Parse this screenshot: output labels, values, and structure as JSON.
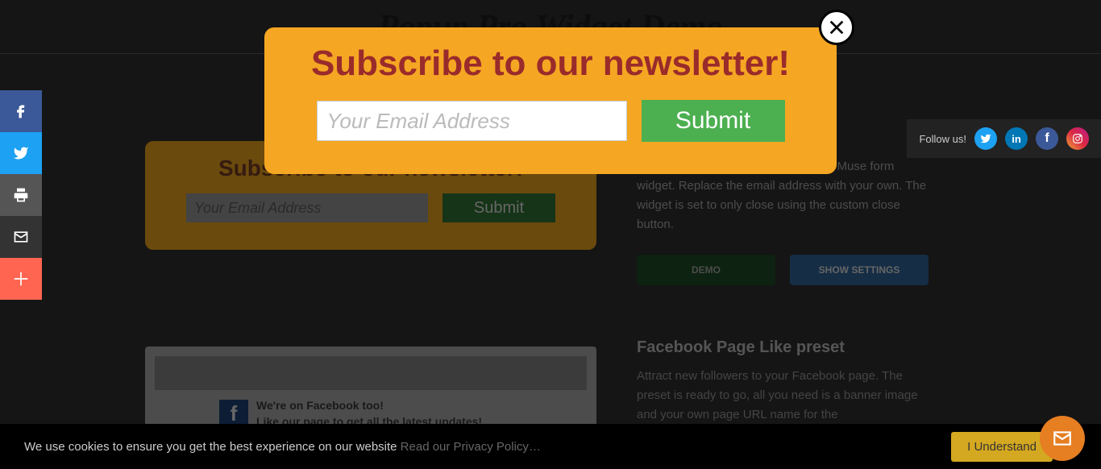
{
  "page_title": "Popup Pro Widget Demo",
  "popup": {
    "title": "Subscribe to our newsletter!",
    "email_placeholder": "Your Email Address",
    "submit_label": "Submit"
  },
  "preview_card": {
    "title": "Subscribe to our newsletter!",
    "email_placeholder": "Your Email Address",
    "submit_label": "Submit"
  },
  "section1": {
    "description": "This widget is based on the standard Muse form widget. Replace the email address with your own. The widget is set to only close using the custom close button.",
    "demo_label": "DEMO",
    "settings_label": "SHOW SETTINGS"
  },
  "section2": {
    "title": "Facebook Page Like preset",
    "description": "Attract new followers to your Facebook page. The preset is ready to go, all you need is a banner image and your own page URL name for the",
    "fb_line1": "We're on Facebook too!",
    "fb_line2": "Like our page to get all the latest updates!"
  },
  "follow": {
    "label": "Follow us!"
  },
  "cookie": {
    "text": "We use cookies to ensure you get the best experience on our website ",
    "link": "Read our Privacy Policy…",
    "button": "I Understand"
  }
}
